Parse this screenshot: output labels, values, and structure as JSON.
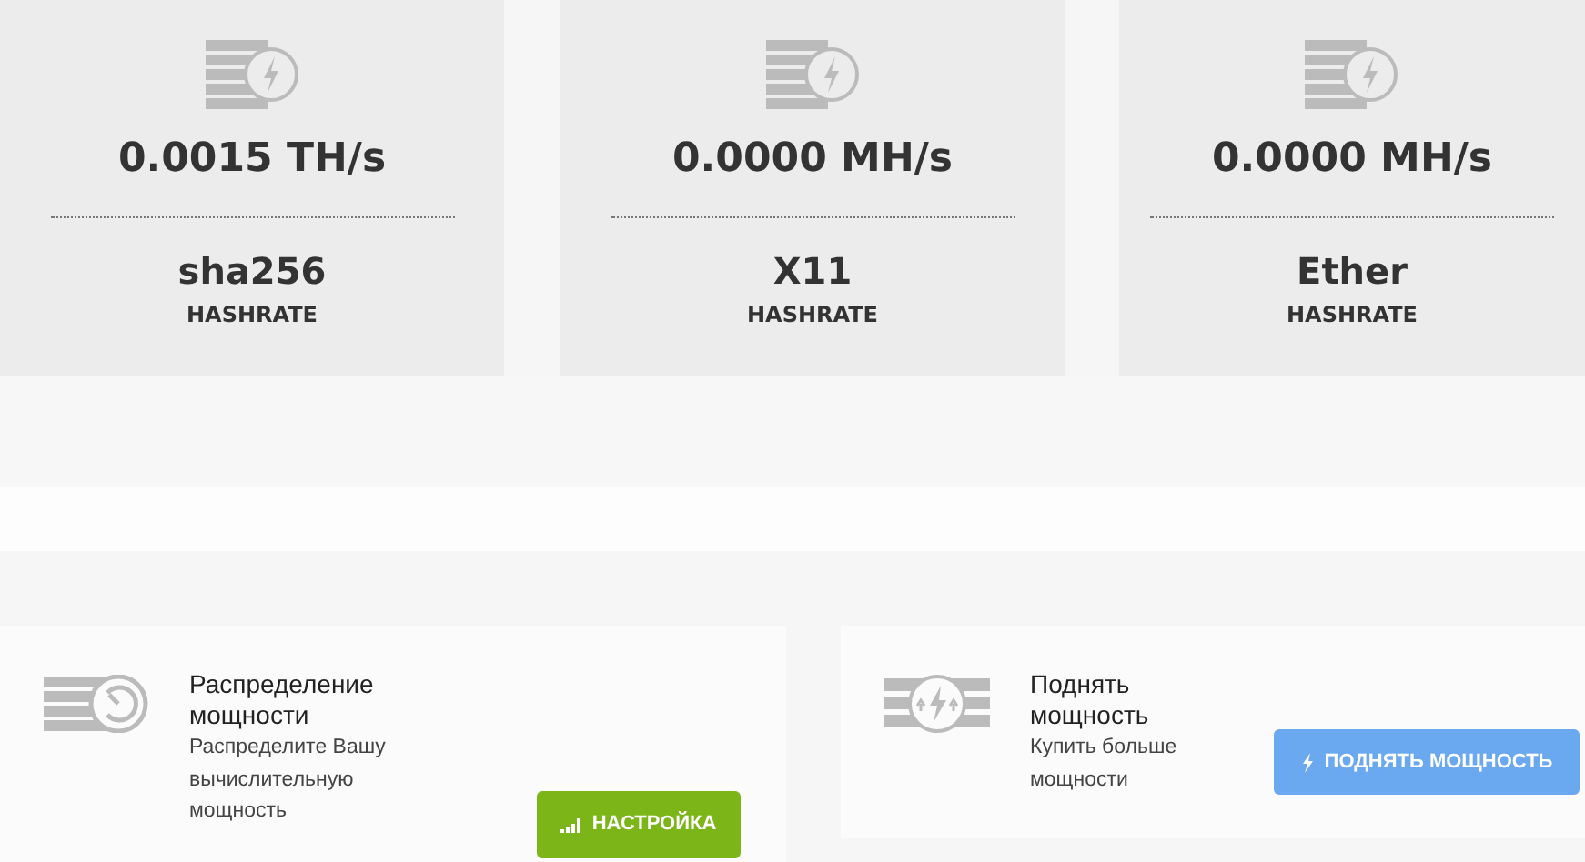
{
  "hashrate_cards": [
    {
      "value": "0.0015 TH/s",
      "algorithm": "sha256",
      "label": "HASHRATE"
    },
    {
      "value": "0.0000 MH/s",
      "algorithm": "X11",
      "label": "HASHRATE"
    },
    {
      "value": "0.0000 MH/s",
      "algorithm": "Ether",
      "label": "HASHRATE"
    }
  ],
  "actions": [
    {
      "kind": "distribute",
      "title": "Распределение мощности",
      "description": "Распределите Вашу вычислительную мощность",
      "button": "НАСТРОЙКА"
    },
    {
      "kind": "upgrade",
      "title": "Поднять мощность",
      "description": "Купить больше мощности",
      "button": "ПОДНЯТЬ МОЩНОСТЬ"
    }
  ]
}
